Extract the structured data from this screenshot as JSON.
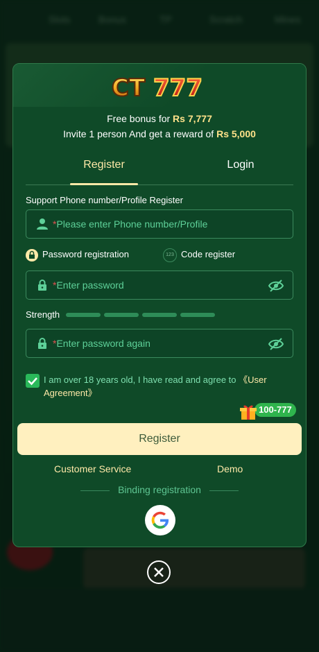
{
  "background_nav": [
    "Slots",
    "Bonus",
    "TP",
    "Scratch",
    "Mines"
  ],
  "modal": {
    "bonus_line1_prefix": "Free bonus for ",
    "bonus_line1_amount": "Rs 7,777",
    "bonus_line2_prefix": "Invite 1 person And get a reward of ",
    "bonus_line2_amount": "Rs 5,000",
    "tabs": {
      "register": "Register",
      "login": "Login"
    },
    "phone_label": "Support Phone number/Profile Register",
    "phone_placeholder": "Please enter Phone number/Profile",
    "required_mark": "*",
    "mode_password": "Password registration",
    "mode_code": "Code register",
    "mode_code_icon_text": "123",
    "password_placeholder": "Enter password",
    "strength_label": "Strength",
    "password_again_placeholder": "Enter password again",
    "agree_text": "I am over 18 years old, I have read and agree to ",
    "agree_link": "《User Agreement》",
    "gift_badge": "100-777",
    "register_button": "Register",
    "customer_service": "Customer Service",
    "demo": "Demo",
    "binding_label": "Binding registration"
  },
  "colors": {
    "accent": "#ffe9a8",
    "modal_bg": "#0f4a28",
    "placeholder": "#5ed199",
    "button_bg": "#fff0bf",
    "check": "#2ab85a"
  },
  "icons": [
    "user-icon",
    "lock-icon",
    "eye-off-icon",
    "gift-icon",
    "google-icon",
    "close-icon",
    "checkmark-icon"
  ]
}
